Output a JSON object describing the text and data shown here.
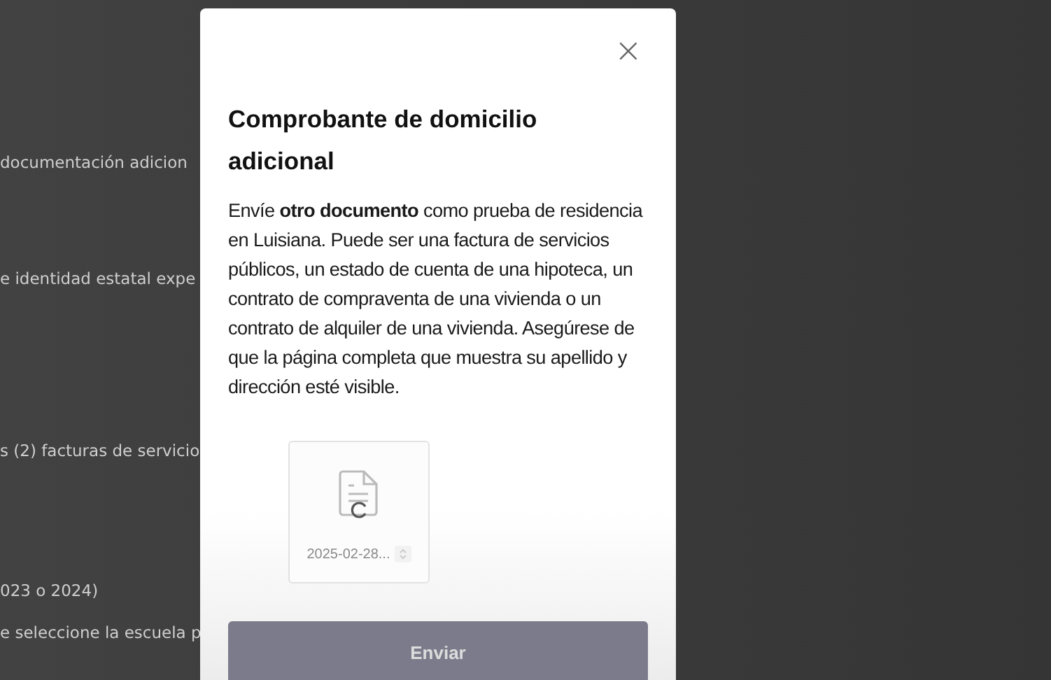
{
  "background_lines": [
    "documentación adicion",
    "e identidad estatal expe",
    "s (2) facturas de servicio",
    "023 o 2024)",
    "e seleccione la escuela p"
  ],
  "modal": {
    "close": "×",
    "title": "Comprobante de domicilio adicional",
    "description": "Envíe **otro documento** como prueba de residencia en Luisiana. Puede ser una factura de servicios públicos, un estado de cuenta de una hipoteca, un contrato de compraventa de una vivienda o un contrato de alquiler de una vivienda. Asegúrese de que la página completa que muestra su apellido y dirección esté visible.",
    "files": [
      {
        "name": "2025-02-28...",
        "loading": true
      }
    ],
    "submit": {
      "label": "Enviar",
      "disabled": true
    }
  }
}
